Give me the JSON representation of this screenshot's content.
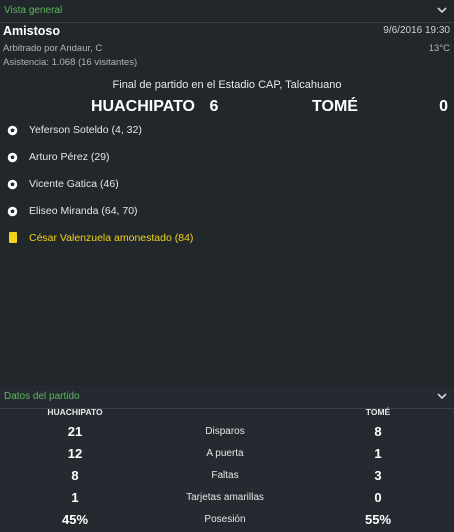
{
  "overview": {
    "section_title": "Vista general",
    "match_title": "Amistoso",
    "date": "9/6/2016 19:30",
    "referee": "Arbitrado por Andaur, C",
    "temperature": "13°C",
    "attendance": "Asistencia: 1.068 (16 visitantes)",
    "final_text": "Final de partido en el Estadio CAP, Talcahuano",
    "home_team": "HUACHIPATO",
    "home_score": "6",
    "away_team": "TOMÉ",
    "away_score": "0",
    "events": [
      {
        "type": "goal",
        "text": "Yeferson Soteldo (4, 32)",
        "icon": "football-icon"
      },
      {
        "type": "goal",
        "text": "Arturo Pérez (29)",
        "icon": "football-icon"
      },
      {
        "type": "goal",
        "text": "Vicente Gatica (46)",
        "icon": "football-icon"
      },
      {
        "type": "goal",
        "text": "Eliseo Miranda (64, 70)",
        "icon": "football-icon"
      },
      {
        "type": "card",
        "text": "César Valenzuela amonestado (84)",
        "icon": "yellow-card-icon",
        "color": "#f2d21b"
      }
    ]
  },
  "stats": {
    "section_title": "Datos del partido",
    "home_team": "HUACHIPATO",
    "away_team": "TOMÉ",
    "rows": [
      {
        "label": "Disparos",
        "home": "21",
        "away": "8"
      },
      {
        "label": "A puerta",
        "home": "12",
        "away": "1"
      },
      {
        "label": "Faltas",
        "home": "8",
        "away": "3"
      },
      {
        "label": "Tarjetas amarillas",
        "home": "1",
        "away": "0"
      },
      {
        "label": "Posesión",
        "home": "45%",
        "away": "55%"
      }
    ]
  },
  "colors": {
    "accent_green": "#5cb85c",
    "card_yellow": "#f2d21b",
    "background": "#22272c"
  }
}
